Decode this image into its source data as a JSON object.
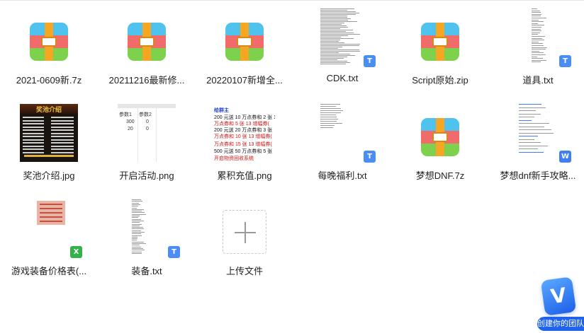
{
  "files": [
    {
      "name": "2021-0609新.7z",
      "type": "archive"
    },
    {
      "name": "20211216最新修...",
      "type": "archive"
    },
    {
      "name": "20220107新增全...",
      "type": "archive"
    },
    {
      "name": "CDK.txt",
      "type": "text",
      "badge": "T"
    },
    {
      "name": "Script原始.zip",
      "type": "archive"
    },
    {
      "name": "道具.txt",
      "type": "text",
      "badge": "T"
    },
    {
      "name": "奖池介绍.jpg",
      "type": "image"
    },
    {
      "name": "开启活动.png",
      "type": "image"
    },
    {
      "name": "累积充值.png",
      "type": "image"
    },
    {
      "name": "每晚福利.txt",
      "type": "text",
      "badge": "T"
    },
    {
      "name": "梦想DNF.7z",
      "type": "archive"
    },
    {
      "name": "梦想dnf新手攻略...",
      "type": "word",
      "badge": "W"
    },
    {
      "name": "游戏装备价格表(...",
      "type": "excel",
      "badge": "X"
    },
    {
      "name": "装备.txt",
      "type": "text",
      "badge": "T"
    },
    {
      "name": "上传文件",
      "type": "upload"
    }
  ],
  "thumbnails": {
    "jiangchi_title": "奖池介绍",
    "huodong_table": {
      "headers": [
        "参数1",
        "参数2"
      ],
      "rows": [
        [
          "300",
          "0"
        ],
        [
          "20",
          "0"
        ]
      ]
    },
    "chongzhi_lines": [
      "给群主",
      "200 元送 10 万点券和 2 张 13",
      "万点券和 5 张 13 增幅券(",
      "200 元送 20 万点券和 3 张",
      "万点券和 10 张 13 增幅券(",
      "万点券和 15 张 13 增幅券(",
      "500 元送 50 万点券和 5 张",
      "开启物资回收系统"
    ]
  },
  "team_badge": {
    "icon": "V",
    "label": "创建你的团队"
  },
  "colors": {
    "text_badge": "#4a8ef5",
    "word_badge": "#3f7ff2",
    "excel_badge": "#34b24a",
    "archive_top": "#4fc3ee",
    "archive_mid": "#f26b6b",
    "archive_bottom": "#7dd14c",
    "archive_strap": "#f5a623"
  }
}
